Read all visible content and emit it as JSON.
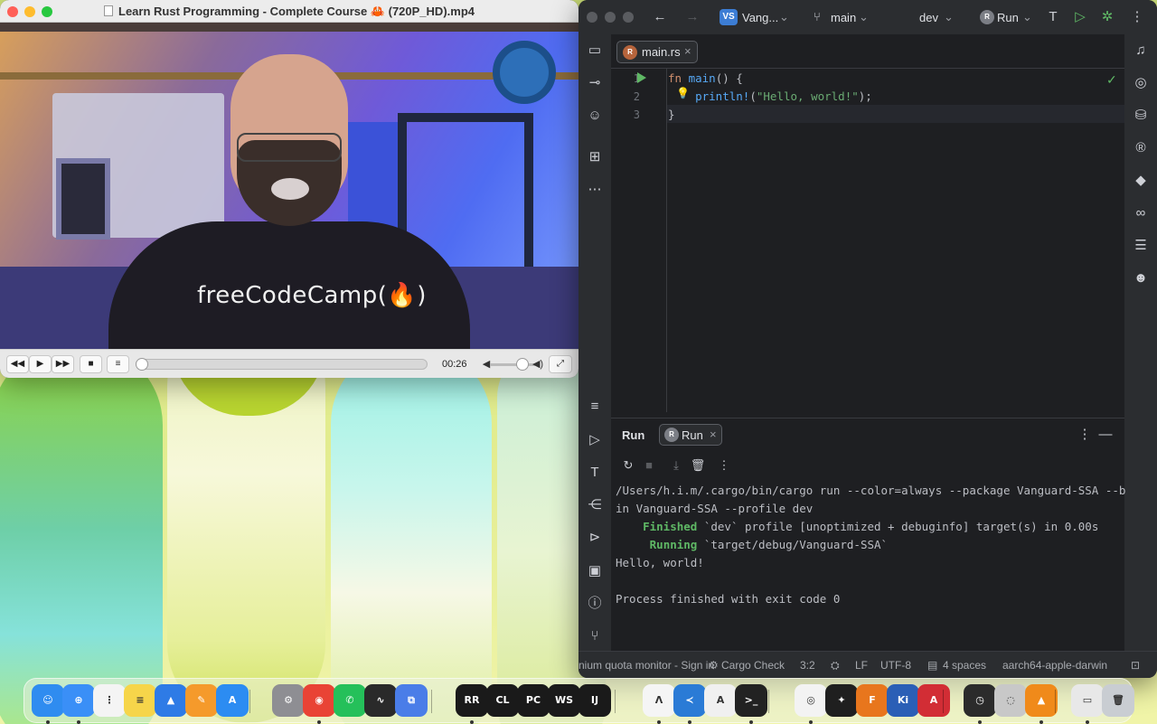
{
  "player": {
    "title": "Learn Rust Programming - Complete Course 🦀 (720P_HD).mp4",
    "shirt_text": "freeCodeCamp(🔥)",
    "time": "00:26",
    "controls": {
      "rewind": "◀◀",
      "play": "▶",
      "forward": "▶▶",
      "stop": "■",
      "playlist": "≡",
      "fullscreen": "⤢"
    }
  },
  "ide": {
    "project": {
      "badge": "VS",
      "name": "Vang..."
    },
    "branch": "main",
    "profile": "dev",
    "run_label": "Run",
    "tab": {
      "label": "main.rs",
      "icon": "rust-icon"
    },
    "code_lines": [
      {
        "num": "1"
      },
      {
        "num": "2"
      },
      {
        "num": "3"
      }
    ],
    "code": {
      "l1_kw": "fn",
      "l1_fn": "main",
      "l1_rest": "() {",
      "l2_macro": "println!",
      "l2_open": "(",
      "l2_str": "\"Hello, world!\"",
      "l2_close": ");",
      "l3": "}"
    },
    "run_panel": {
      "title": "Run",
      "chip": "Run",
      "console": {
        "cmd1": "/Users/h.i.m/.cargo/bin/cargo run --color=always --package Vanguard-SSA --b",
        "cmd2": "in Vanguard-SSA --profile dev",
        "finished_word": "Finished",
        "finished_rest": " `dev` profile [unoptimized + debuginfo] target(s) in 0.00s",
        "running_word": "Running",
        "running_rest": " `target/debug/Vanguard-SSA`",
        "output": "Hello, world!",
        "exit": "Process finished with exit code 0"
      }
    },
    "status": {
      "quota": "nium quota monitor - Sign in",
      "cargo_check": "Cargo Check",
      "position": "3:2",
      "line_ending": "LF",
      "encoding": "UTF-8",
      "indent": "4 spaces",
      "target": "aarch64-apple-darwin"
    }
  },
  "dock": {
    "apps": [
      {
        "name": "finder",
        "label": "☺",
        "color": "#2f8cf0"
      },
      {
        "name": "safari",
        "label": "⊕",
        "color": "#3a8ff7"
      },
      {
        "name": "reminders",
        "label": "⋮",
        "color": "#f4f4f4"
      },
      {
        "name": "notes",
        "label": "≡",
        "color": "#f6d54a"
      },
      {
        "name": "keynote",
        "label": "▲",
        "color": "#2e7be6"
      },
      {
        "name": "pages",
        "label": "✎",
        "color": "#f59a2b"
      },
      {
        "name": "app-store",
        "label": "A",
        "color": "#2c8cf2"
      },
      {
        "name": "system-settings",
        "label": "⚙",
        "color": "#8e8e93"
      },
      {
        "name": "chrome",
        "label": "◉",
        "color": "#e94335"
      },
      {
        "name": "whatsapp",
        "label": "✆",
        "color": "#25c05a"
      },
      {
        "name": "activity-monitor",
        "label": "∿",
        "color": "#2a2a2a"
      },
      {
        "name": "remote-desktop",
        "label": "⧉",
        "color": "#4a7de8"
      },
      {
        "name": "rustrover",
        "label": "RR",
        "color": "#1a1a1a"
      },
      {
        "name": "clion",
        "label": "CL",
        "color": "#1a1a1a"
      },
      {
        "name": "pycharm",
        "label": "PC",
        "color": "#1a1a1a"
      },
      {
        "name": "webstorm",
        "label": "WS",
        "color": "#1a1a1a"
      },
      {
        "name": "intellij",
        "label": "IJ",
        "color": "#1a1a1a"
      },
      {
        "name": "arc",
        "label": "Λ",
        "color": "#f5f5f5"
      },
      {
        "name": "vscode",
        "label": "≺",
        "color": "#2a7bd6"
      },
      {
        "name": "xcode-tools",
        "label": "A",
        "color": "#f0f0f0"
      },
      {
        "name": "terminal",
        "label": ">_",
        "color": "#222222"
      },
      {
        "name": "blender",
        "label": "◎",
        "color": "#f3f3f3"
      },
      {
        "name": "figma",
        "label": "✦",
        "color": "#1f1f1f"
      },
      {
        "name": "fusion",
        "label": "F",
        "color": "#e8761d"
      },
      {
        "name": "kicad",
        "label": "Ki",
        "color": "#2b5fb6"
      },
      {
        "name": "autocad",
        "label": "A",
        "color": "#d22d35"
      },
      {
        "name": "time-machine",
        "label": "◷",
        "color": "#2b2b2b"
      },
      {
        "name": "disk-utility",
        "label": "◌",
        "color": "#c8c8c8"
      },
      {
        "name": "vlc",
        "label": "▲",
        "color": "#f08a1a"
      },
      {
        "name": "preview",
        "label": "▭",
        "color": "#e8e8e8"
      },
      {
        "name": "trash",
        "label": "🗑",
        "color": "#c9cdd2"
      }
    ]
  }
}
